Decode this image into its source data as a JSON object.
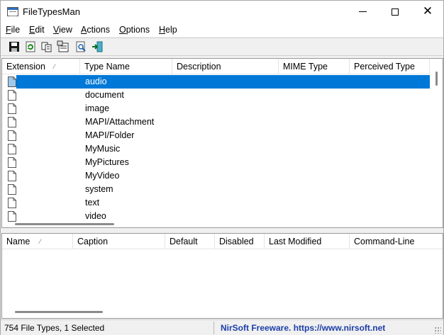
{
  "window": {
    "title": "FileTypesMan",
    "close_glyph": "✕"
  },
  "menu": [
    {
      "accel": "F",
      "rest": "ile"
    },
    {
      "accel": "E",
      "rest": "dit"
    },
    {
      "accel": "V",
      "rest": "iew"
    },
    {
      "accel": "A",
      "rest": "ctions"
    },
    {
      "accel": "O",
      "rest": "ptions"
    },
    {
      "accel": "H",
      "rest": "elp"
    }
  ],
  "toolbar": {
    "icons": [
      "save-icon",
      "refresh-icon",
      "copy-icon",
      "properties-icon",
      "find-icon",
      "exit-icon"
    ]
  },
  "top_table": {
    "columns": [
      "Extension",
      "Type Name",
      "Description",
      "MIME Type",
      "Perceived Type"
    ],
    "sort_indicator": "⁄",
    "rows": [
      "audio",
      "document",
      "image",
      "MAPI/Attachment",
      "MAPI/Folder",
      "MyMusic",
      "MyPictures",
      "MyVideo",
      "system",
      "text",
      "video"
    ],
    "selected_index": 0
  },
  "bottom_table": {
    "columns": [
      "Name",
      "Caption",
      "Default",
      "Disabled",
      "Last Modified",
      "Command-Line"
    ],
    "sort_indicator": "⁄"
  },
  "status": {
    "count_text": "754 File Types, 1 Selected",
    "freeware_text": "NirSoft Freeware. https://www.nirsoft.net"
  },
  "colors": {
    "selection": "#0078d7",
    "link": "#1c3ea8"
  }
}
